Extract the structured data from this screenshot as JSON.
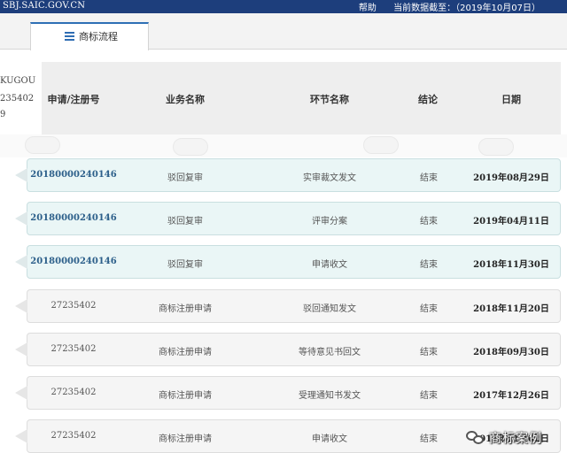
{
  "topbar": {
    "site": "SBJ.SAIC.GOV.CN",
    "help": "帮助",
    "data_as_of_label": "当前数据截至：",
    "data_as_of_value": "（2019年10月07日）"
  },
  "tab": {
    "icon": "list-icon",
    "label": "商标流程"
  },
  "left_panel": {
    "line1": "KUGOU",
    "line2": "235402",
    "line3": "9"
  },
  "table": {
    "headers": {
      "reg_no": "申请/注册号",
      "business": "业务名称",
      "step": "环节名称",
      "result": "结论",
      "date": "日期"
    },
    "rows": [
      {
        "reg_no": "20180000240146",
        "business": "驳回复审",
        "step": "实审裁文发文",
        "result": "结束",
        "date": "2019年08月29日",
        "style": "teal"
      },
      {
        "reg_no": "20180000240146",
        "business": "驳回复审",
        "step": "评审分案",
        "result": "结束",
        "date": "2019年04月11日",
        "style": "teal"
      },
      {
        "reg_no": "20180000240146",
        "business": "驳回复审",
        "step": "申请收文",
        "result": "结束",
        "date": "2018年11月30日",
        "style": "teal"
      },
      {
        "reg_no": "27235402",
        "business": "商标注册申请",
        "step": "驳回通知发文",
        "result": "结束",
        "date": "2018年11月20日",
        "style": "gray"
      },
      {
        "reg_no": "27235402",
        "business": "商标注册申请",
        "step": "等待意见书回文",
        "result": "结束",
        "date": "2018年09月30日",
        "style": "gray"
      },
      {
        "reg_no": "27235402",
        "business": "商标注册申请",
        "step": "受理通知书发文",
        "result": "结束",
        "date": "2017年12月26日",
        "style": "gray"
      },
      {
        "reg_no": "27235402",
        "business": "商标注册申请",
        "step": "申请收文",
        "result": "结束",
        "date": "2017年11月02日",
        "style": "gray"
      }
    ]
  },
  "watermark": {
    "icon": "wechat-icon",
    "text": "商标案例"
  },
  "colors": {
    "topbar": "#1d3e7c",
    "tab_accent": "#2e6fb5",
    "row_teal": "#eaf6f6",
    "row_gray": "#f5f5f5",
    "link_blue": "#2c5f8a"
  }
}
